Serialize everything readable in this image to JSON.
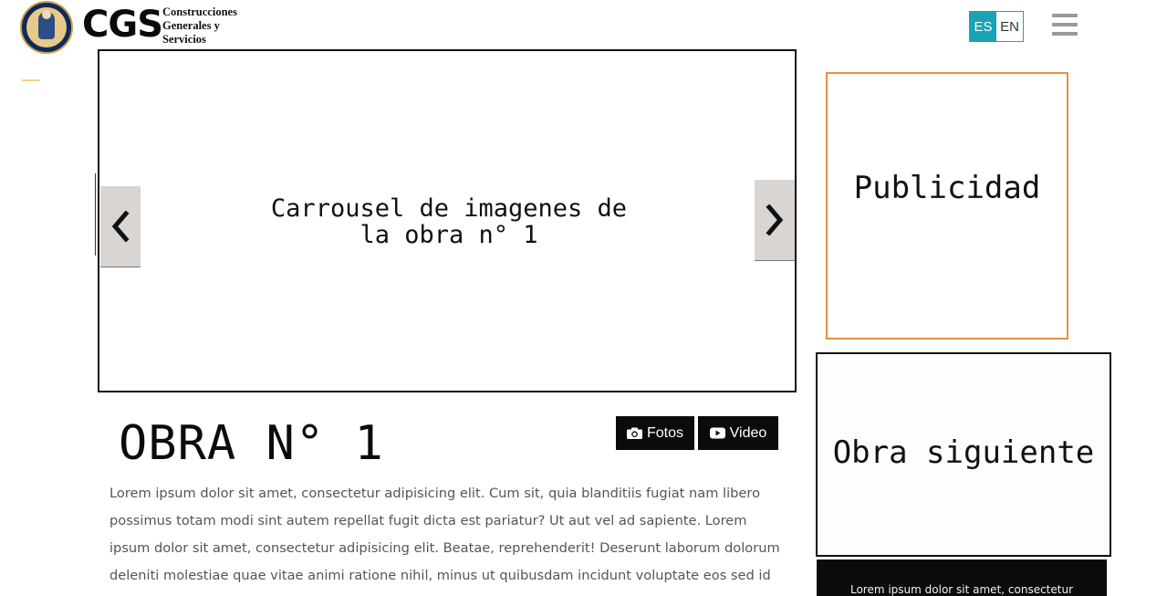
{
  "header": {
    "logo_text": "CGS",
    "logo_subtitle_lines": [
      "Construcciones",
      "Generales y",
      "Servicios"
    ],
    "languages": [
      {
        "label": "ES",
        "active": true
      },
      {
        "label": "EN",
        "active": false
      }
    ],
    "menu_icon": "hamburger-menu-icon"
  },
  "carousel": {
    "caption_line1": "Carrousel de imagenes de",
    "caption_line2": "la obra n° 1",
    "prev_icon": "chevron-left-icon",
    "next_icon": "chevron-right-icon"
  },
  "obra": {
    "title": "OBRA N° 1",
    "fotos_label": "Fotos",
    "video_label": "Video",
    "fotos_icon": "camera-icon",
    "video_icon": "youtube-play-icon",
    "description": "Lorem ipsum dolor sit amet, consectetur adipisicing elit. Cum sit, quia blanditiis fugiat nam libero possimus totam modi sint autem repellat fugit dicta est pariatur? Ut aut vel ad sapiente. Lorem ipsum dolor sit amet, consectetur adipisicing elit. Beatae, reprehenderit! Deserunt laborum dolorum deleniti molestiae quae vitae animi ratione nihil, minus ut quibusdam incidunt voluptate eos sed id"
  },
  "sidebar": {
    "ad_label": "Publicidad",
    "next_label": "Obra siguiente",
    "card_text": "Lorem ipsum dolor sit amet, consectetur"
  },
  "colors": {
    "accent_teal": "#1aa3b5",
    "ad_border_orange": "#e8913a",
    "button_black": "#0b0b0b",
    "arrow_gray": "#d8d5d3"
  }
}
